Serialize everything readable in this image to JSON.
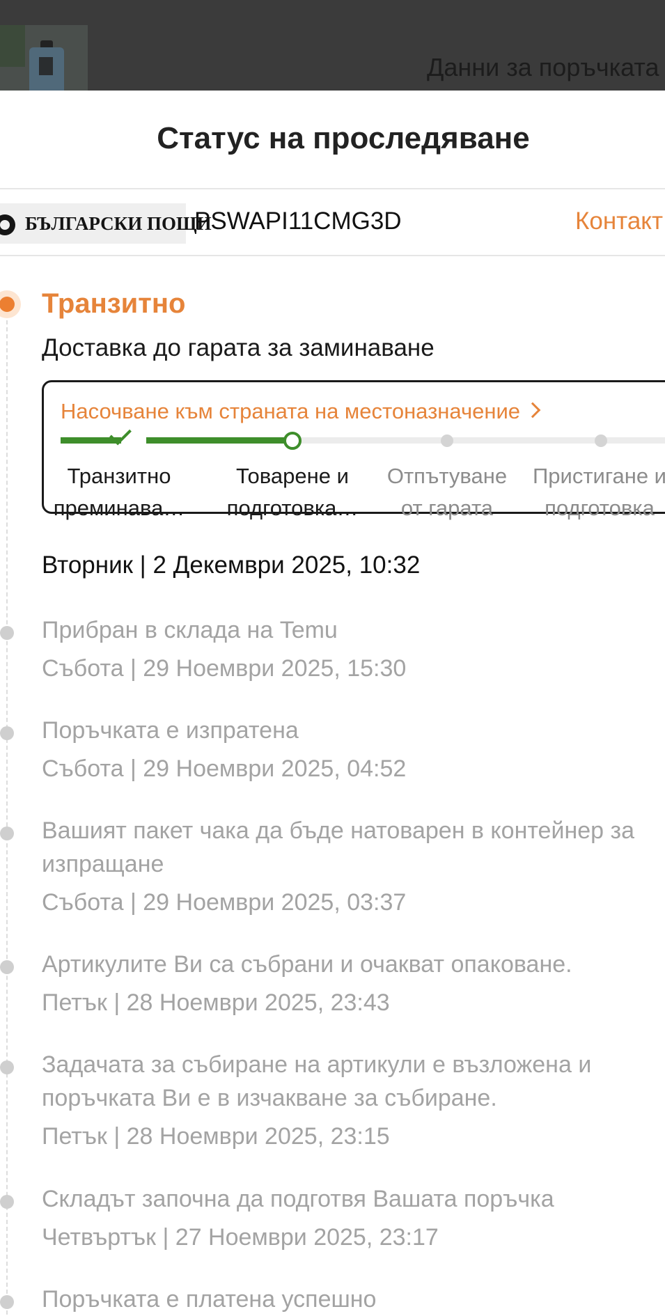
{
  "background": {
    "header_partial_text": "Данни за поръчката"
  },
  "sheet": {
    "title": "Статус на проследяване",
    "carrier_name": "БЪЛГАРСКИ ПОЩИ",
    "tracking_number": "PSWAPI11CMG3D",
    "contact_label": "Контакт"
  },
  "current_status": {
    "title": "Транзитно",
    "subtitle": "Доставка до гарата за заминаване",
    "link_label": "Насочване към страната на местоназначение",
    "progress_fraction": 0.375,
    "steps": [
      {
        "line1": "Транзитно",
        "line2": "преминава…",
        "state": "done"
      },
      {
        "line1": "Товарене и",
        "line2": "подготовка…",
        "state": "current"
      },
      {
        "line1": "Отпътуване",
        "line2": "от гарата",
        "state": "todo"
      },
      {
        "line1": "Пристигане и",
        "line2": "подготовка",
        "state": "todo"
      }
    ],
    "date": "Вторник | 2 Декември 2025, 10:32"
  },
  "events": [
    {
      "title": "Прибран в склада на Temu",
      "date": "Събота | 29 Ноември 2025, 15:30"
    },
    {
      "title": "Поръчката е изпратена",
      "date": "Събота | 29 Ноември 2025, 04:52"
    },
    {
      "title": "Вашият пакет чака да бъде натоварен в контейнер за изпращане",
      "date": "Събота | 29 Ноември 2025, 03:37"
    },
    {
      "title": "Артикулите Ви са събрани и очакват опаковане.",
      "date": "Петък | 28 Ноември 2025, 23:43"
    },
    {
      "title": "Задачата за събиране на артикули е възложена и поръчката Ви е в изчакване за събиране.",
      "date": "Петък | 28 Ноември 2025, 23:15"
    },
    {
      "title": "Складът започна да подготвя Вашата поръчка",
      "date": "Четвъртък | 27 Ноември 2025, 23:17"
    },
    {
      "title": "Поръчката е платена успешно",
      "date": ""
    }
  ],
  "colors": {
    "accent": "#e6843a",
    "progress_green": "#3e8e2b",
    "muted_text": "#a3a3a3"
  }
}
